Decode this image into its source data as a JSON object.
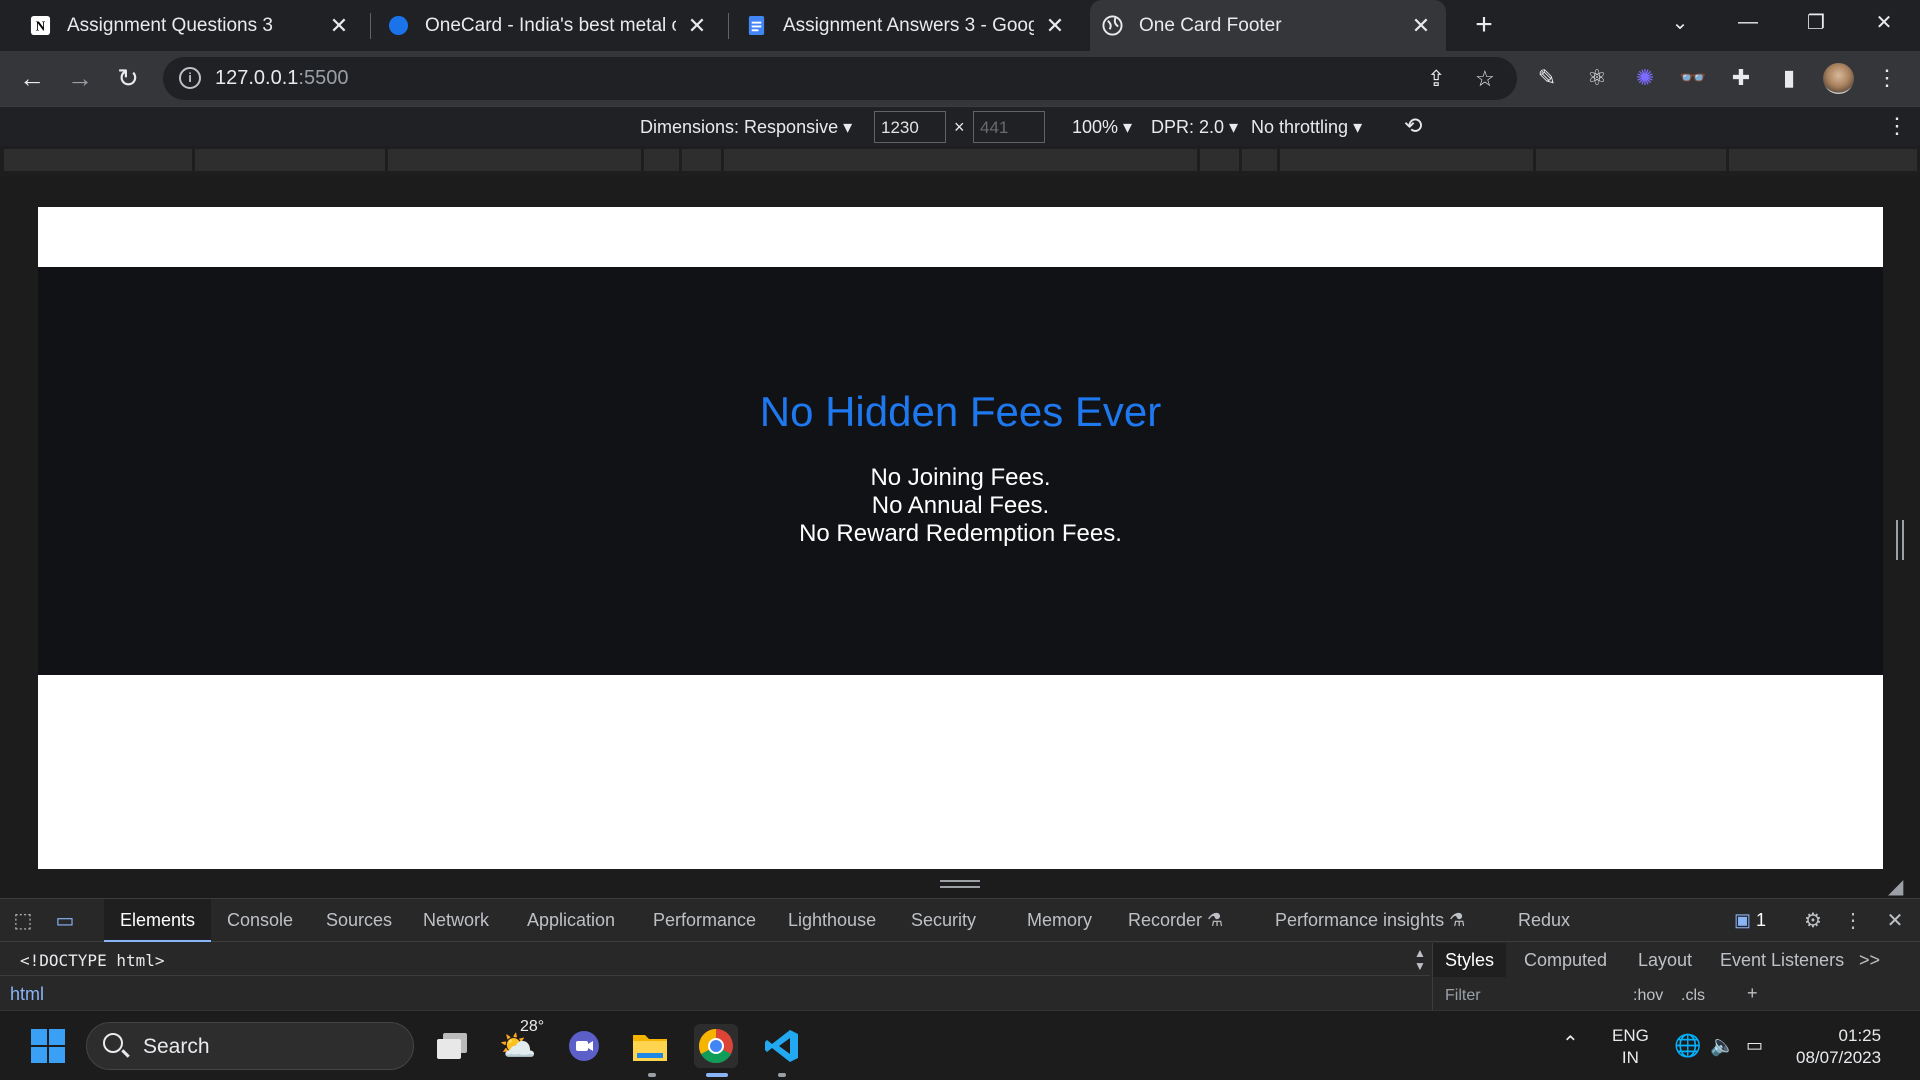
{
  "browser": {
    "tabs": [
      {
        "title": "Assignment Questions 3",
        "favicon": "notion-icon",
        "active": false
      },
      {
        "title": "OneCard - India's best metal credit card",
        "favicon": "onecard-icon",
        "active": false
      },
      {
        "title": "Assignment Answers 3 - Google Docs",
        "favicon": "docs-icon",
        "active": false
      },
      {
        "title": "One Card Footer",
        "favicon": "globe-icon",
        "active": true
      }
    ],
    "new_tab": "+",
    "url_host": "127.0.0.1",
    "url_port": ":5500"
  },
  "device_toolbar": {
    "dimensions_label": "Dimensions: Responsive",
    "width": "1230",
    "height_placeholder": "441",
    "times": "×",
    "zoom": "100%",
    "dpr": "DPR: 2.0",
    "throttling": "No throttling"
  },
  "page": {
    "heading": "No Hidden Fees Ever",
    "lines": [
      "No Joining Fees.",
      "No Annual Fees.",
      "No Reward Redemption Fees."
    ]
  },
  "devtools": {
    "tabs": [
      "Elements",
      "Console",
      "Sources",
      "Network",
      "Application",
      "Performance",
      "Lighthouse",
      "Security",
      "Memory",
      "Recorder",
      "Performance insights",
      "Redux"
    ],
    "active_tab": "Elements",
    "issues_count": "1",
    "doctype": "<!DOCTYPE html>",
    "breadcrumb": "html",
    "side_tabs": [
      "Styles",
      "Computed",
      "Layout",
      "Event Listeners"
    ],
    "side_more": ">>",
    "filter_placeholder": "Filter",
    "hov": ":hov",
    "cls": ".cls"
  },
  "taskbar": {
    "search_label": "Search",
    "weather_temp": "28°",
    "language": "ENG",
    "region": "IN",
    "time": "01:25",
    "date": "08/07/2023"
  },
  "colors": {
    "heading_blue": "#1e78ef",
    "footer_bg": "#111215",
    "tab_active": "#35363a"
  }
}
